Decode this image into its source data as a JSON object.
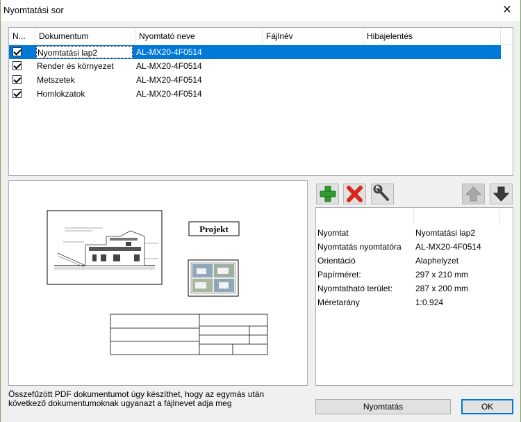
{
  "window": {
    "title": "Nyomtatási sor",
    "close_icon": "×"
  },
  "grid": {
    "columns": [
      "N...",
      "Dokumentum",
      "Nyomtató neve",
      "Fájlnév",
      "Hibajelentés"
    ],
    "rows": [
      {
        "document": "Nyomtatási lap2",
        "printer": "AL-MX20-4F0514",
        "checked": true,
        "selected": true
      },
      {
        "document": "Render és környezet",
        "printer": "AL-MX20-4F0514",
        "checked": true,
        "selected": false
      },
      {
        "document": "Metszetek",
        "printer": "AL-MX20-4F0514",
        "checked": true,
        "selected": false
      },
      {
        "document": "Homlokzatok",
        "printer": "AL-MX20-4F0514",
        "checked": true,
        "selected": false
      }
    ]
  },
  "preview": {
    "project_label": "Projekt"
  },
  "toolbar": {
    "add_icon": "plus-icon",
    "delete_icon": "x-icon",
    "settings_icon": "wrench-icon",
    "up_icon": "arrow-up-icon",
    "down_icon": "arrow-down-icon"
  },
  "properties": [
    {
      "key": "Nyomtat",
      "value": "Nyomtatási lap2"
    },
    {
      "key": "Nyomtatás nyomtatóra",
      "value": "AL-MX20-4F0514"
    },
    {
      "key": "Orientáció",
      "value": "Alaphelyzet"
    },
    {
      "key": "Papírméret:",
      "value": "297 x 210 mm"
    },
    {
      "key": "Nyomtatható terület:",
      "value": "287 x 200 mm"
    },
    {
      "key": "Méretarány",
      "value": "1:0.924"
    }
  ],
  "footer": {
    "info": "Összefűzött PDF dokumentumot úgy készíthet, hogy az egymás után következő dokumentumoknak ugyanazt a fájlnevet adja meg",
    "print_button": "Nyomtatás",
    "ok_button": "OK"
  },
  "colors": {
    "selection": "#0078d7",
    "add_green": "#2e9e2e",
    "delete_red": "#d9261c"
  }
}
